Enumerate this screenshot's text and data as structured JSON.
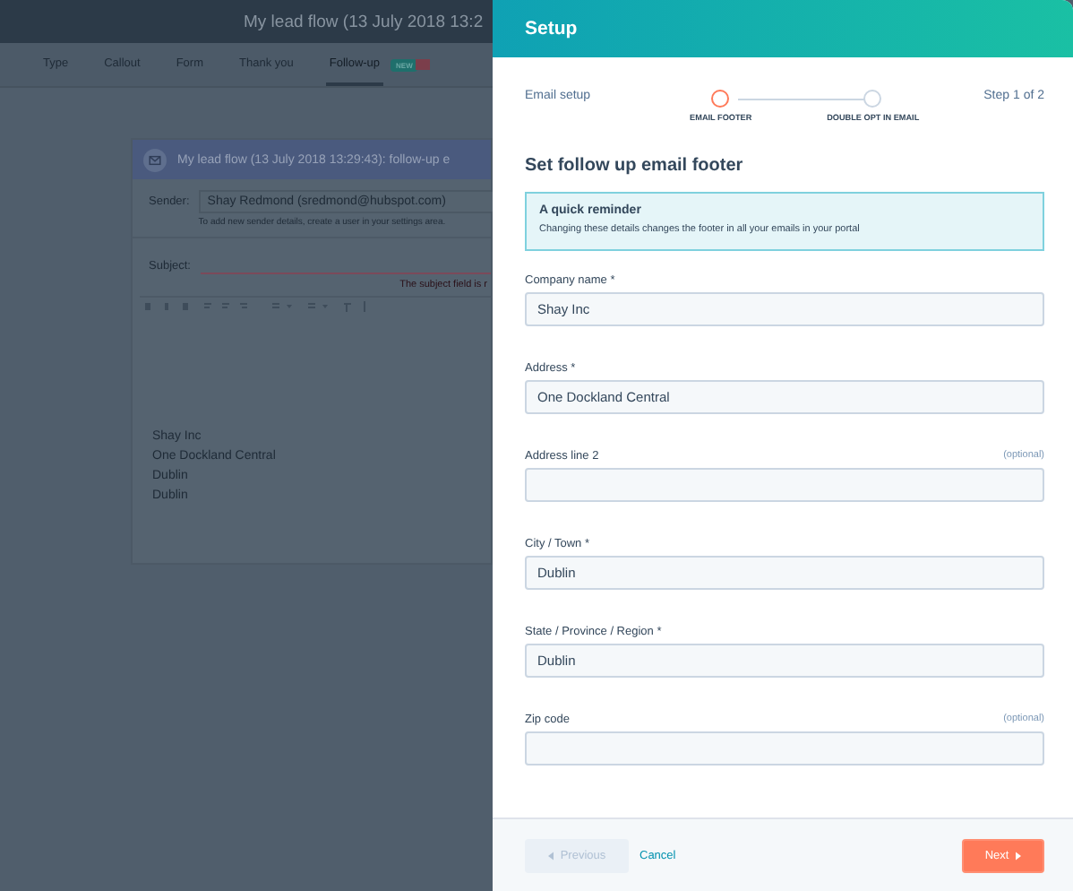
{
  "background_app": {
    "title": "My lead flow (13 July 2018 13:2",
    "tabs": [
      {
        "label": "Type",
        "selected": false
      },
      {
        "label": "Callout",
        "selected": false
      },
      {
        "label": "Form",
        "selected": false
      },
      {
        "label": "Thank you",
        "selected": false
      },
      {
        "label": "Follow-up",
        "selected": true,
        "badge": "NEW"
      }
    ],
    "email_card": {
      "title": "My lead flow (13 July 2018 13:29:43): follow-up e",
      "sender_label": "Sender:",
      "sender_value": "Shay Redmond (sredmond@hubspot.com)",
      "sender_hint": "To add new sender details, create a user in your settings area.",
      "subject_label": "Subject:",
      "subject_error": "The subject field is r",
      "body_lines": [
        "Shay Inc",
        "One Dockland Central",
        "Dublin",
        "Dublin"
      ]
    }
  },
  "panel": {
    "title": "Setup",
    "setup_label": "Email setup",
    "step_counter": "Step 1 of 2",
    "steps": [
      {
        "label": "EMAIL FOOTER",
        "selected": true
      },
      {
        "label": "DOUBLE OPT IN EMAIL",
        "selected": false
      }
    ],
    "heading": "Set follow up email footer",
    "reminder": {
      "title": "A quick reminder",
      "text": "Changing these details changes the footer in all your emails in your portal"
    },
    "fields": [
      {
        "label": "Company name *",
        "value": "Shay Inc"
      },
      {
        "label": "Address *",
        "value": "One Dockland Central"
      },
      {
        "label": "Address line 2",
        "hint": "(optional)"
      },
      {
        "label": "City / Town *",
        "value": "Dublin"
      },
      {
        "label": "State / Province / Region *",
        "value": "Dublin"
      },
      {
        "label": "Zip code",
        "hint": "(optional)"
      }
    ],
    "footer": {
      "previous": {
        "label": "Previous",
        "disabled": true
      },
      "cancel": "Cancel",
      "next": {
        "label": "Next",
        "disabled": false
      }
    }
  }
}
